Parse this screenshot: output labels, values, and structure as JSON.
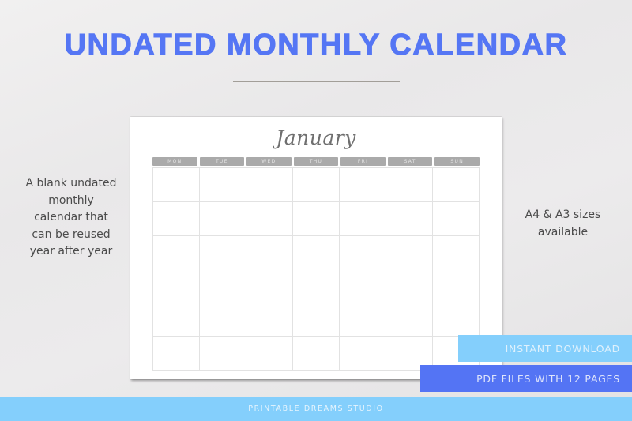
{
  "header": {
    "title": "UNDATED MONTHLY CALENDAR",
    "title_color": "#5576f4"
  },
  "calendar": {
    "month": "January",
    "weekdays": [
      "MON",
      "TUE",
      "WED",
      "THU",
      "FRI",
      "SAT",
      "SUN"
    ],
    "rows": 6,
    "columns": 7
  },
  "left_description": "A blank undated monthly calendar that can be reused year after year",
  "right_description": "A4 & A3 sizes available",
  "badges": {
    "instant_download": "INSTANT DOWNLOAD",
    "pdf_files": "PDF FILES WITH 12 PAGES"
  },
  "footer": {
    "brand": "PRINTABLE DREAMS STUDIO"
  },
  "colors": {
    "accent_blue": "#5474f4",
    "light_blue": "#84cffc"
  }
}
